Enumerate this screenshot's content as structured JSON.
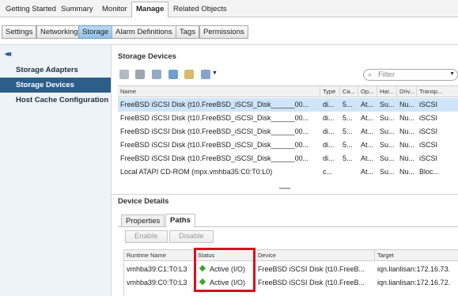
{
  "top_tabs": [
    "Getting Started",
    "Summary",
    "Monitor",
    "Manage",
    "Related Objects"
  ],
  "sub_tabs": [
    "Settings",
    "Networking",
    "Storage",
    "Alarm Definitions",
    "Tags",
    "Permissions"
  ],
  "left_nav": {
    "items": [
      "Storage Adapters",
      "Storage Devices",
      "Host Cache Configuration"
    ]
  },
  "storage_devices": {
    "title": "Storage Devices",
    "filter_placeholder": "Filter",
    "toolbar_icons": [
      "refresh-icon",
      "rescan-icon",
      "attach-icon",
      "detach-icon",
      "mark-icon",
      "actions-icon"
    ],
    "columns": [
      "Name",
      "Type",
      "Ca...",
      "Op...",
      "Har...",
      "Driv...",
      "Transp..."
    ],
    "rows": [
      [
        "FreeBSD iSCSI Disk (t10.FreeBSD_iSCSI_Disk______00...",
        "di...",
        "5...",
        "At...",
        "Su...",
        "Nu...",
        "iSCSI"
      ],
      [
        "FreeBSD iSCSI Disk (t10.FreeBSD_iSCSI_Disk______00...",
        "di...",
        "5...",
        "At...",
        "Su...",
        "Nu...",
        "iSCSI"
      ],
      [
        "FreeBSD iSCSI Disk (t10.FreeBSD_iSCSI_Disk______00...",
        "di...",
        "5...",
        "At...",
        "Su...",
        "Nu...",
        "iSCSI"
      ],
      [
        "FreeBSD iSCSI Disk (t10.FreeBSD_iSCSI_Disk______00...",
        "di...",
        "5...",
        "At...",
        "Su...",
        "Nu...",
        "iSCSI"
      ],
      [
        "FreeBSD iSCSI Disk (t10.FreeBSD_iSCSI_Disk______00...",
        "di...",
        "5...",
        "At...",
        "Su...",
        "Nu...",
        "iSCSI"
      ],
      [
        "Local ATAPI CD-ROM (mpx.vmhba35:C0:T0:L0)",
        "c...",
        "",
        "At...",
        "Su...",
        "Nu...",
        "Bloc..."
      ]
    ]
  },
  "device_details": {
    "title": "Device Details",
    "tabs": [
      "Properties",
      "Paths"
    ],
    "enable_label": "Enable",
    "disable_label": "Disable",
    "columns": [
      "Runtime Name",
      "Status",
      "Device",
      "Target"
    ],
    "rows": [
      [
        "vmhba39:C1:T0:L3",
        "Active (I/O)",
        "FreeBSD iSCSI Disk (t10.FreeB...",
        "iqn.lianlisan:172.16.73."
      ],
      [
        "vmhba39:C0:T0:L3",
        "Active (I/O)",
        "FreeBSD iSCSI Disk (t10.FreeB...",
        "iqn.lianlisan:172.16.72."
      ]
    ]
  },
  "colors": {
    "highlight": "#d9111b",
    "active_status": "#3fa436",
    "selected_nav": "#2c5e8a",
    "selected_row": "#cfe5f9"
  }
}
